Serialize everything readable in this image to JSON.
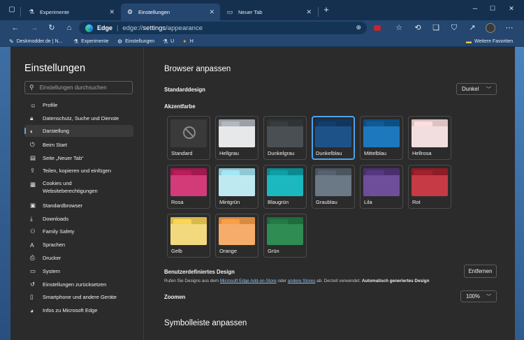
{
  "tabs": [
    {
      "title": "Experimente",
      "icon": "flask-icon",
      "active": false
    },
    {
      "title": "Einstellungen",
      "icon": "gear-icon",
      "active": true
    },
    {
      "title": "Neuer Tab",
      "icon": "newtab-page-icon",
      "active": false
    }
  ],
  "address": {
    "brand": "Edge",
    "url_prefix": "edge://",
    "url_path": "settings",
    "url_rest": "/appearance"
  },
  "favorites": {
    "items": [
      {
        "label": "Deskmodder.de | N...",
        "icon": "deskmodder-icon"
      },
      {
        "label": "Experimente",
        "icon": "flask-icon"
      },
      {
        "label": "Einstellungen",
        "icon": "gear-icon"
      },
      {
        "label": "U",
        "icon": "flask-icon"
      },
      {
        "label": "H",
        "icon": "puzzle-icon"
      }
    ],
    "more_label": "Weitere Favoriten"
  },
  "sidebar": {
    "title": "Einstellungen",
    "search_placeholder": "Einstellungen durchsuchen",
    "items": [
      {
        "label": "Profile",
        "icon": "profile-icon"
      },
      {
        "label": "Datenschutz, Suche und Dienste",
        "icon": "lock-icon"
      },
      {
        "label": "Darstellung",
        "icon": "appearance-icon",
        "active": true
      },
      {
        "label": "Beim Start",
        "icon": "power-icon"
      },
      {
        "label": "Seite „Neuer Tab“",
        "icon": "newtab-icon"
      },
      {
        "label": "Teilen, kopieren und einfügen",
        "icon": "share-icon"
      },
      {
        "label": "Cookies und",
        "label2": "Websiteberechtigungen",
        "icon": "cookie-icon"
      },
      {
        "label": "Standardbrowser",
        "icon": "browser-icon"
      },
      {
        "label": "Downloads",
        "icon": "download-icon"
      },
      {
        "label": "Family Safety",
        "icon": "family-icon"
      },
      {
        "label": "Sprachen",
        "icon": "language-icon"
      },
      {
        "label": "Drucker",
        "icon": "printer-icon"
      },
      {
        "label": "System",
        "icon": "system-icon"
      },
      {
        "label": "Einstellungen zurücksetzen",
        "icon": "reset-icon"
      },
      {
        "label": "Smartphone und andere Geräte",
        "icon": "phone-icon"
      },
      {
        "label": "Infos zu Microsoft Edge",
        "icon": "edge-icon"
      }
    ]
  },
  "main": {
    "heading": "Browser anpassen",
    "default_design_label": "Standarddesign",
    "default_design_value": "Dunkel",
    "accent_label": "Akzentfarbe",
    "accents": [
      {
        "name": "Standard",
        "back": "",
        "front": ""
      },
      {
        "name": "Hellgrau",
        "back": "#9aa0a6",
        "front": "#e6e8ea"
      },
      {
        "name": "Dunkelgrau",
        "back": "#2f3438",
        "front": "#4a4f54"
      },
      {
        "name": "Dunkelblau",
        "back": "#10365f",
        "front": "#1d5289",
        "selected": true
      },
      {
        "name": "Mittelblau",
        "back": "#0d4f82",
        "front": "#1d78bd"
      },
      {
        "name": "Hellrosa",
        "back": "#dcc2c2",
        "front": "#f2dede"
      },
      {
        "name": "Rosa",
        "back": "#a3184e",
        "front": "#d33b78"
      },
      {
        "name": "Mintgrün",
        "back": "#8fc9d4",
        "front": "#bfe9f0"
      },
      {
        "name": "Blaugrün",
        "back": "#0a8a90",
        "front": "#1cb8bf"
      },
      {
        "name": "Graublau",
        "back": "#4a5560",
        "front": "#6b7885"
      },
      {
        "name": "Lila",
        "back": "#4a2f70",
        "front": "#6e4e9a"
      },
      {
        "name": "Rot",
        "back": "#8f1c27",
        "front": "#c53a44"
      },
      {
        "name": "Gelb",
        "back": "#d9b94a",
        "front": "#f3d97e"
      },
      {
        "name": "Orange",
        "back": "#d98a3e",
        "front": "#f6ac6a"
      },
      {
        "name": "Grün",
        "back": "#1e6b3c",
        "front": "#2f8c52"
      }
    ],
    "custom_label": "Benutzerdefiniertes Design",
    "custom_desc_1": "Rufen Sie Designs aus dem ",
    "custom_link_1": "Microsoft Edge Add-on-Store",
    "custom_desc_2": " oder ",
    "custom_link_2": "andere Stores",
    "custom_desc_3": " ab. Derzeit verwendet: ",
    "custom_current": "Automatisch generiertes Design",
    "remove_button": "Entfernen",
    "zoom_label": "Zoomen",
    "zoom_value": "100%",
    "toolbar_heading": "Symbolleiste anpassen"
  }
}
